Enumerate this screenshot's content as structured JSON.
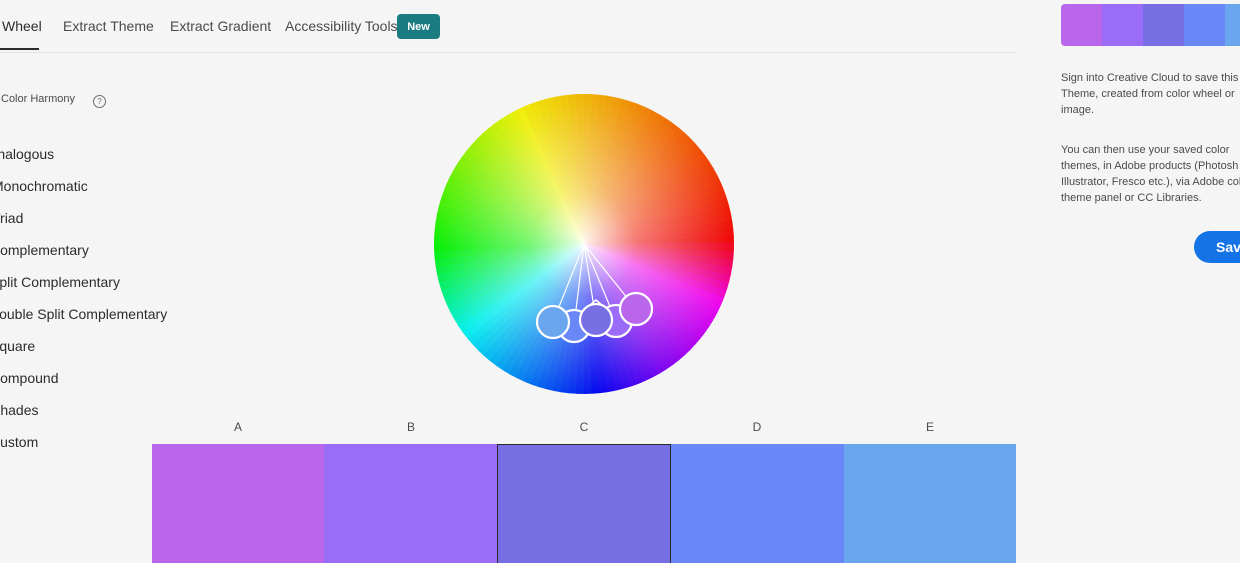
{
  "tabs": [
    {
      "label": "Wheel",
      "active": true
    },
    {
      "label": "Extract Theme"
    },
    {
      "label": "Extract Gradient"
    },
    {
      "label": "Accessibility Tools"
    }
  ],
  "new_badge": "New",
  "harmony": {
    "title": "Color Harmony",
    "help": "?",
    "rules": [
      "Analogous",
      "Monochromatic",
      "Triad",
      "Complementary",
      "Split Complementary",
      "Double Split Complementary",
      "Square",
      "Compound",
      "Shades",
      "Custom"
    ]
  },
  "swatches": [
    {
      "label": "A",
      "color": "#BA66EA"
    },
    {
      "label": "B",
      "color": "#9A6CF8"
    },
    {
      "label": "C",
      "color": "#796FE4",
      "selected": true
    },
    {
      "label": "D",
      "color": "#6A87F7"
    },
    {
      "label": "E",
      "color": "#69A6EE"
    }
  ],
  "right_panel": {
    "mini_colors": [
      "#BA66EA",
      "#9A6CF8",
      "#796FE4",
      "#6A87F7",
      "#69A6EE"
    ],
    "sign_in_lines": [
      "Sign into Creative Cloud to save this C",
      "Theme, created from color wheel or",
      "image."
    ],
    "info_lines": [
      "You can then use your saved color",
      "themes, in Adobe products (Photosh",
      "Illustrator, Fresco etc.), via Adobe col",
      "theme panel or CC Libraries."
    ],
    "save_label": "Save"
  }
}
